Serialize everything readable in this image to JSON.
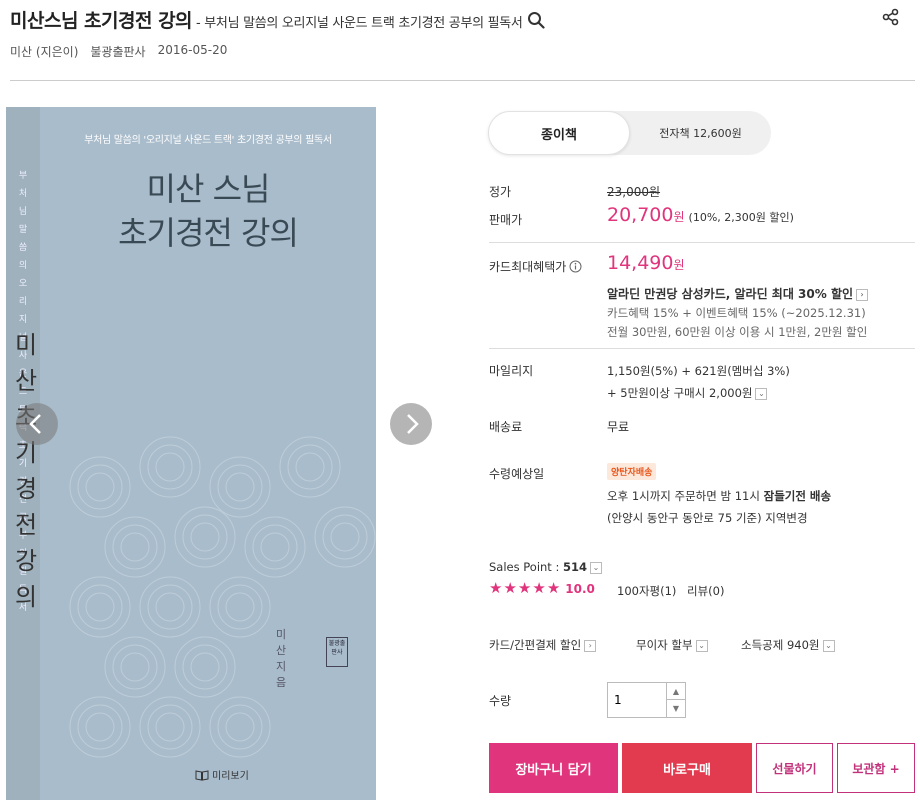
{
  "header": {
    "title": "미산스님 초기경전 강의",
    "subtitle": "- 부처님 말씀의 오리지널 사운드 트랙 초기경전 공부의 필독서",
    "author": "미산 (지은이)",
    "publisher": "불광출판사",
    "date": "2016-05-20"
  },
  "cover": {
    "top_text": "부처님 말씀의 '오리지널 사운드 트랙' 초기경전 공부의 필독서",
    "title_line1": "미산 스님",
    "title_line2": "초기경전 강의",
    "spine_small": "부처님 말씀의 오리지널 사운드 트랙 초기경전 공부의 필독서",
    "spine_big": "미산 초기경전 강의",
    "author": "미산 지음",
    "publisher_mark": "불광출판사"
  },
  "preview_label": "미리보기",
  "tabs": {
    "paper": "종이책",
    "ebook": "전자책 12,600원"
  },
  "price": {
    "list_label": "정가",
    "list_value": "23,000원",
    "sale_label": "판매가",
    "sale_amount": "20,700",
    "sale_unit": "원",
    "sale_note": "(10%, 2,300원 할인)"
  },
  "card": {
    "label": "카드최대혜택가",
    "amount": "14,490",
    "unit": "원",
    "line1": "알라딘 만권당 삼성카드, 알라딘 최대 30% 할인",
    "line2": "카드혜택 15% + 이벤트혜택 15% (~2025.12.31)",
    "line3": "전월 30만원, 60만원 이상 이용 시 1만원, 2만원 할인"
  },
  "mileage": {
    "label": "마일리지",
    "line1": "1,150원(5%) + 621원(멤버십 3%)",
    "line2": "+ 5만원이상 구매시 2,000원"
  },
  "shipping": {
    "label": "배송료",
    "value": "무료"
  },
  "delivery": {
    "label": "수령예상일",
    "badge": "양탄자배송",
    "line1_pre": "오후 1시까지 주문하면 밤 11시 ",
    "line1_bold": "잠들기전 배송",
    "line2": "(안양시 동안구 동안로 75 기준) 지역변경"
  },
  "sales": {
    "label": "Sales Point : ",
    "value": "514",
    "rating": "10.0",
    "rating_stars": 5,
    "reviews_count": "100자평(1)",
    "reviews": "리뷰(0)"
  },
  "options": {
    "card_pay": "카드/간편결제 할인",
    "installment": "무이자 할부",
    "tax": "소득공제 940원"
  },
  "quantity": {
    "label": "수량",
    "value": "1"
  },
  "buttons": {
    "cart": "장바구니 담기",
    "buy": "바로구매",
    "gift": "선물하기",
    "save": "보관함 +"
  },
  "colors": {
    "accent": "#e0347c",
    "buy": "#e23b4f",
    "badge_text": "#e8581f",
    "badge_bg": "#fde9dc",
    "cover": "#a9bccb"
  }
}
